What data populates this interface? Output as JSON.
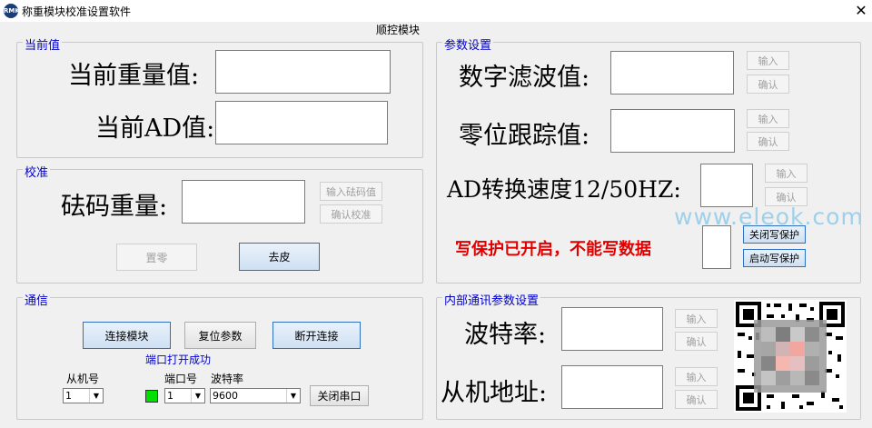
{
  "window": {
    "title": "称重模块校准设置软件",
    "icon_text": "RMK",
    "center_label": "顺控模块",
    "close_glyph": "✕"
  },
  "current": {
    "legend": "当前值",
    "weight_label": "当前重量值:",
    "ad_label": "当前AD值:",
    "weight_value": "",
    "ad_value": ""
  },
  "calibration": {
    "legend": "校准",
    "weight_label": "砝码重量:",
    "weight_value": "",
    "input_button": "输入砝码值",
    "confirm_button": "确认校准",
    "zero_button": "置零",
    "tare_button": "去皮"
  },
  "comm": {
    "legend": "通信",
    "connect_button": "连接模块",
    "reset_button": "复位参数",
    "disconnect_button": "断开连接",
    "status_text": "端口打开成功",
    "slave_label": "从机号",
    "port_label": "端口号",
    "baud_label": "波特率",
    "slave_value": "1",
    "port_value": "1",
    "baud_value": "9600",
    "close_port_button": "关闭串口",
    "led_color": "#00e000"
  },
  "params": {
    "legend": "参数设置",
    "filter_label": "数字滤波值:",
    "zero_track_label": "零位跟踪值:",
    "ad_speed_label": "AD转换速度12/50HZ:",
    "input_label": "输入",
    "confirm_label": "确认",
    "write_protect_status": "写保护已开启，不能写数据",
    "close_protect_button": "关闭写保护",
    "open_protect_button": "启动写保护"
  },
  "internal": {
    "legend": "内部通讯参数设置",
    "baud_label": "波特率:",
    "slave_label": "从机地址:",
    "input_label": "输入",
    "confirm_label": "确认"
  },
  "watermark": "www.eleok.com"
}
